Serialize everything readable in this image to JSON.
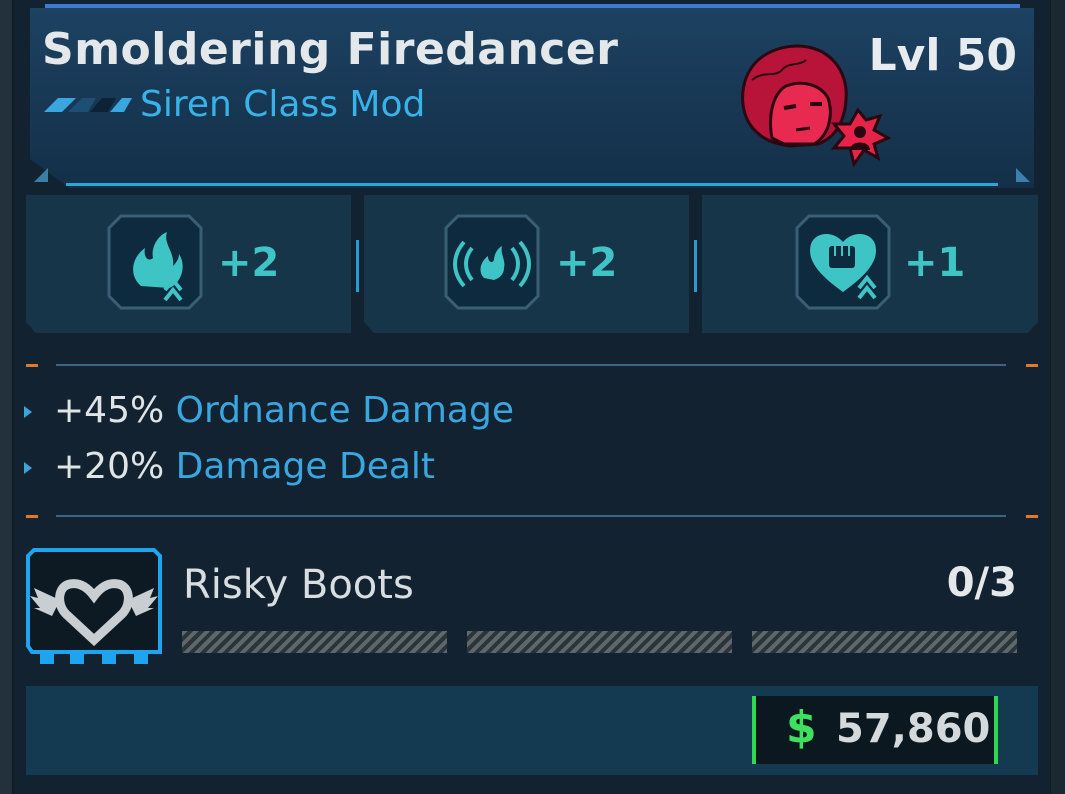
{
  "item": {
    "name": "Smoldering Firedancer",
    "type": "Siren Class Mod",
    "level": "Lvl 50",
    "class_icon": "siren-portrait-icon"
  },
  "skills": [
    {
      "icon": "flame-skill-icon",
      "bonus": "+2"
    },
    {
      "icon": "fire-aura-skill-icon",
      "bonus": "+2"
    },
    {
      "icon": "fist-heart-skill-icon",
      "bonus": "+1"
    }
  ],
  "stats": [
    {
      "value": "+45%",
      "name": "Ordnance Damage"
    },
    {
      "value": "+20%",
      "name": "Damage Dealt"
    }
  ],
  "challenge": {
    "icon": "winged-heart-icon",
    "name": "Risky Boots",
    "progress": "0/3",
    "completed_segments": 0,
    "total_segments": 3
  },
  "price": {
    "symbol": "$",
    "value": "57,860"
  },
  "colors": {
    "accent_blue": "#37b3ea",
    "skill_teal": "#3fc4c6",
    "money_green": "#2ed850",
    "tick_orange": "#e07a2a",
    "portrait_red": "#e8234a"
  }
}
